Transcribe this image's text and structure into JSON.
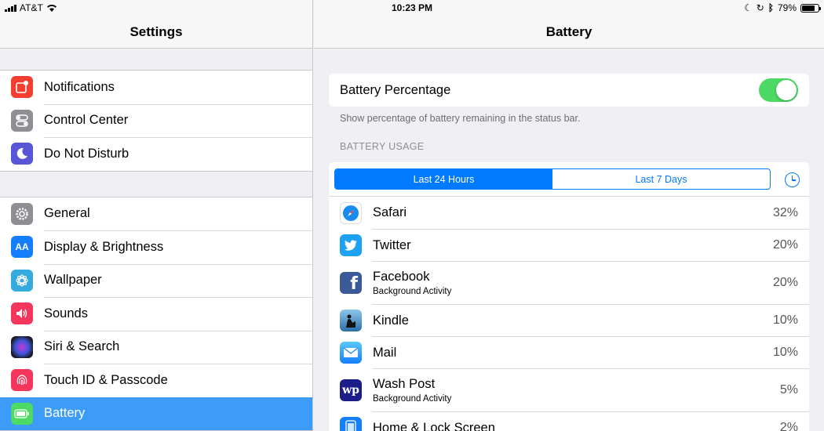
{
  "status": {
    "carrier": "AT&T",
    "time": "10:23 PM",
    "battery_pct": "79%"
  },
  "left": {
    "title": "Settings",
    "group1": [
      {
        "label": "Notifications",
        "icon": "notifications-icon",
        "color": "#f53d30"
      },
      {
        "label": "Control Center",
        "icon": "control-center-icon",
        "color": "#8e8e93"
      },
      {
        "label": "Do Not Disturb",
        "icon": "moon-icon",
        "color": "#5856d6"
      }
    ],
    "group2": [
      {
        "label": "General",
        "icon": "gear-icon",
        "color": "#8e8e93"
      },
      {
        "label": "Display & Brightness",
        "icon": "display-icon",
        "color": "#147efb"
      },
      {
        "label": "Wallpaper",
        "icon": "wallpaper-icon",
        "color": "#35aadc"
      },
      {
        "label": "Sounds",
        "icon": "speaker-icon",
        "color": "#f5365c"
      },
      {
        "label": "Siri & Search",
        "icon": "siri-icon",
        "color": "#2c2c3c"
      },
      {
        "label": "Touch ID & Passcode",
        "icon": "fingerprint-icon",
        "color": "#f5365c"
      },
      {
        "label": "Battery",
        "icon": "battery-icon",
        "color": "#4cd964"
      }
    ]
  },
  "right": {
    "title": "Battery",
    "battery_percentage_label": "Battery Percentage",
    "battery_percentage_on": true,
    "footnote": "Show percentage of battery remaining in the status bar.",
    "section_header": "BATTERY USAGE",
    "segments": [
      "Last 24 Hours",
      "Last 7 Days"
    ],
    "selected_segment": "Last 24 Hours",
    "apps": [
      {
        "name": "Safari",
        "sub": "",
        "pct": "32%",
        "icon": "safari-icon",
        "color": "#1a8cf0"
      },
      {
        "name": "Twitter",
        "sub": "",
        "pct": "20%",
        "icon": "twitter-icon",
        "color": "#1da1f2"
      },
      {
        "name": "Facebook",
        "sub": "Background Activity",
        "pct": "20%",
        "icon": "facebook-icon",
        "color": "#3b5998"
      },
      {
        "name": "Kindle",
        "sub": "",
        "pct": "10%",
        "icon": "kindle-icon",
        "color": "#2b6fa8"
      },
      {
        "name": "Mail",
        "sub": "",
        "pct": "10%",
        "icon": "mail-icon",
        "color": "#2a8cf2"
      },
      {
        "name": "Wash Post",
        "sub": "Background Activity",
        "pct": "5%",
        "icon": "wash-post-icon",
        "color": "#1d1d8a"
      },
      {
        "name": "Home & Lock Screen",
        "sub": "",
        "pct": "2%",
        "icon": "home-lock-icon",
        "color": "#147efb"
      }
    ]
  }
}
